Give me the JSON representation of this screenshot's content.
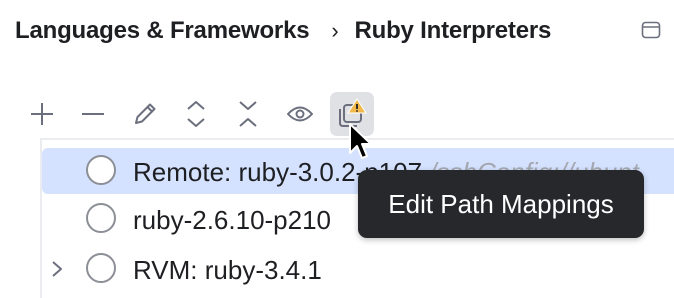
{
  "breadcrumb": {
    "parent": "Languages & Frameworks",
    "separator": "›",
    "current": "Ruby Interpreters"
  },
  "toolbar": {
    "buttons": [
      {
        "name": "add",
        "icon": "plus-icon"
      },
      {
        "name": "remove",
        "icon": "minus-icon"
      },
      {
        "name": "edit",
        "icon": "pencil-icon"
      },
      {
        "name": "expand-all",
        "icon": "expand-icon"
      },
      {
        "name": "collapse-all",
        "icon": "collapse-icon"
      },
      {
        "name": "show",
        "icon": "eye-icon"
      },
      {
        "name": "edit-path-mappings",
        "icon": "path-mappings-warning-icon",
        "hovered": true
      }
    ]
  },
  "interpreters": [
    {
      "label": "Remote: ruby-3.0.2-p107",
      "path": "/sshConfig://ubunt",
      "selected": true,
      "expandable": false
    },
    {
      "label": "ruby-2.6.10-p210",
      "path": "",
      "selected": false,
      "expandable": false
    },
    {
      "label": "RVM: ruby-3.4.1",
      "path": "",
      "selected": false,
      "expandable": true
    }
  ],
  "tooltip": {
    "text": "Edit Path Mappings"
  },
  "colors": {
    "selection": "#d4e2ff",
    "tooltip_bg": "#26282c",
    "warning": "#f2b84b",
    "hover": "#dfe1e5"
  }
}
